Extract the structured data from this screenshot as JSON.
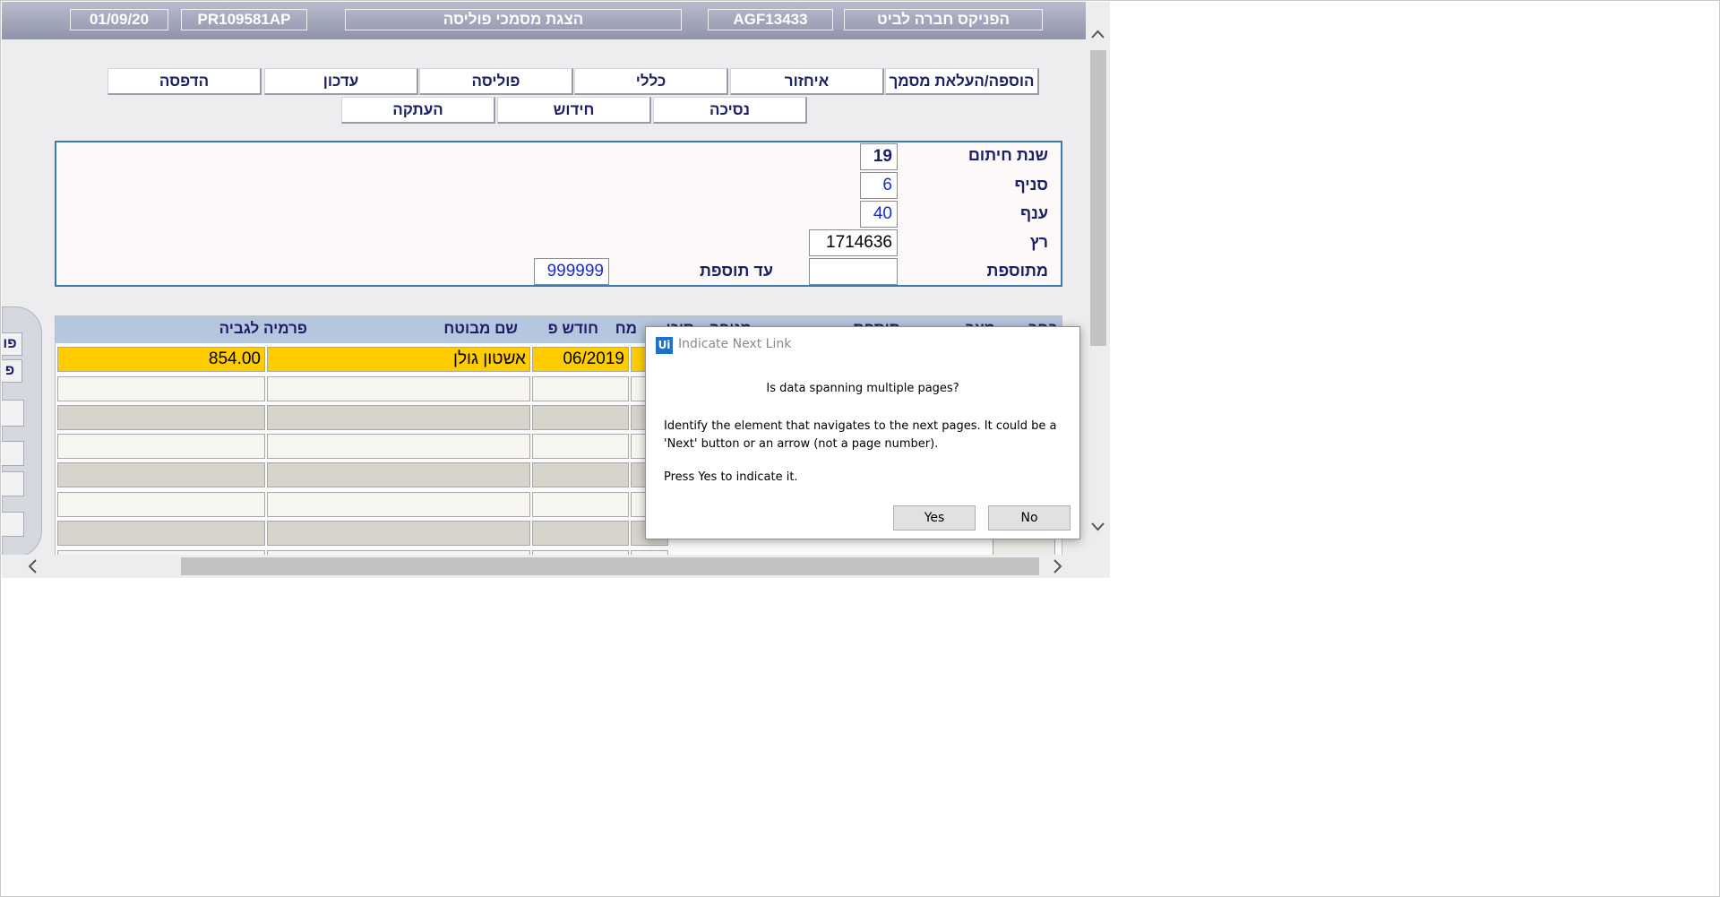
{
  "header": {
    "company": "הפניקס חברה לביט",
    "agent_code": "AGF13433",
    "screen_title": "הצגת מסמכי פוליסה",
    "policy_code": "PR109581AP",
    "date": "01/09/20"
  },
  "tabs_row1": [
    "הוספה/העלאת מסמך",
    "איחזור",
    "כללי",
    "פוליסה",
    "עדכון",
    "הדפסה"
  ],
  "tabs_row2": [
    "נסיכה",
    "חידוש",
    "העתקה"
  ],
  "form": {
    "year_label": "שנת חיתום",
    "year_value": "19",
    "branch_label": "סניף",
    "branch_value": "6",
    "sector_label": "ענף",
    "sector_value": "40",
    "serial_label": "רץ",
    "serial_value": "1714636",
    "from_addition_label": "מתוספת",
    "from_addition_value": "",
    "to_addition_label": "עד  תוספת",
    "to_addition_value": "999999"
  },
  "grid": {
    "headers": [
      "פרמיה לגביה",
      "שם מבוטח",
      "חודש פ",
      "מח",
      "סוכן",
      "מנופה",
      "תוספת",
      "מצב",
      "בחר"
    ],
    "row1": {
      "premium": "854.00",
      "insured": "אשטון גולן",
      "month": "06/2019"
    }
  },
  "left_panel": {
    "btn1": "פו",
    "btn2": "פ"
  },
  "dialog": {
    "logo": "Ui",
    "title": "Indicate Next Link",
    "question": "Is data spanning multiple pages?",
    "body": "Identify the element that navigates to the next pages. It could be a 'Next' button or an arrow (not a page number).",
    "note": "Press Yes to indicate it.",
    "yes": "Yes",
    "no": "No"
  },
  "colors": {
    "header_bg": "#9ea1b6",
    "selected_row": "#ffcc00",
    "panel_border": "#3b79b5",
    "grid_header": "#b5c6df"
  }
}
